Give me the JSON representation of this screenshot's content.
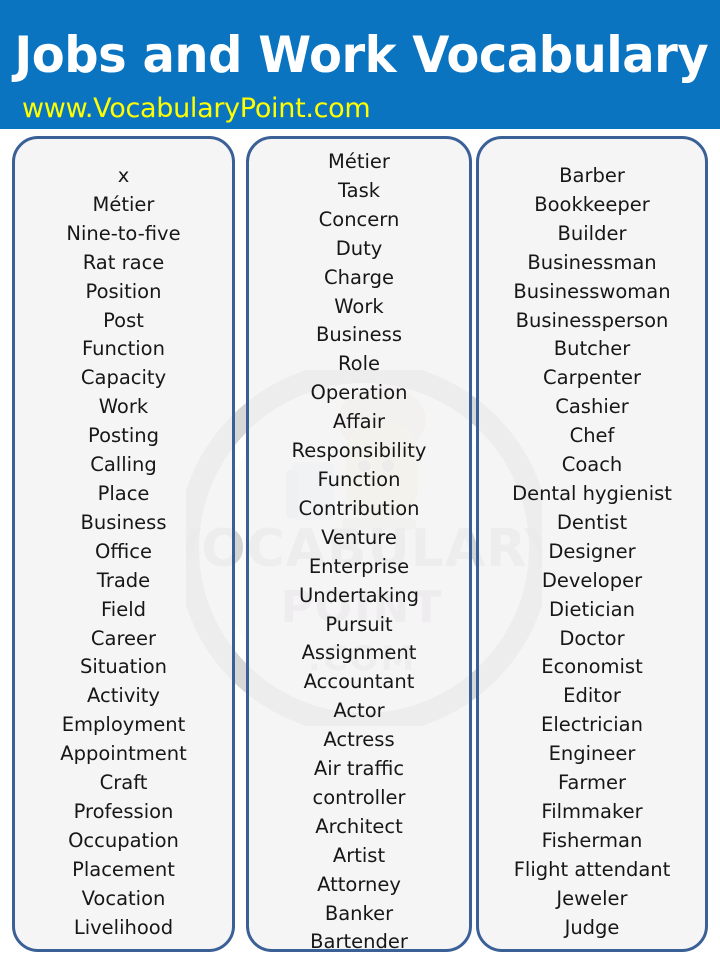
{
  "header": {
    "title": "Jobs and Work Vocabulary",
    "url": "www.VocabularyPoint.com",
    "background_color": "#0a74c1",
    "title_color": "#ffffff",
    "url_color": "#ffff00"
  },
  "watermark": {
    "brand_line_1": "VOCABULARY",
    "brand_line_2": "POINT",
    "brand_line_3": ".COM",
    "color": "#c9c9c9"
  },
  "card_style": {
    "border_color": "#3a6095",
    "fill_color": "#f2f2f2",
    "text_color": "#171717"
  },
  "columns": [
    {
      "id": "column-1",
      "items": [
        "x",
        "Métier",
        "Nine-to-five",
        "Rat race",
        "Position",
        "Post",
        "Function",
        "Capacity",
        "Work",
        "Posting",
        "Calling",
        "Place",
        "Business",
        "Office",
        "Trade",
        "Field",
        "Career",
        "Situation",
        "Activity",
        "Employment",
        "Appointment",
        "Craft",
        "Profession",
        "Occupation",
        "Placement",
        "Vocation",
        "Livelihood"
      ]
    },
    {
      "id": "column-2",
      "items": [
        "Métier",
        "Task",
        "Concern",
        "Duty",
        "Charge",
        "Work",
        "Business",
        "Role",
        "Operation",
        "Affair",
        "Responsibility",
        "Function",
        "Contribution",
        "Venture",
        "Enterprise",
        "Undertaking",
        "Pursuit",
        "Assignment",
        "Accountant",
        "Actor",
        "Actress",
        "Air traffic",
        "controller",
        "Architect",
        "Artist",
        "Attorney",
        "Banker",
        "Bartender"
      ]
    },
    {
      "id": "column-3",
      "items": [
        "Barber",
        "Bookkeeper",
        "Builder",
        "Businessman",
        "Businesswoman",
        "Businessperson",
        "Butcher",
        "Carpenter",
        "Cashier",
        "Chef",
        "Coach",
        "Dental hygienist",
        "Dentist",
        "Designer",
        "Developer",
        "Dietician",
        "Doctor",
        "Economist",
        "Editor",
        "Electrician",
        "Engineer",
        "Farmer",
        "Filmmaker",
        "Fisherman",
        "Flight attendant",
        "Jeweler",
        "Judge"
      ]
    }
  ]
}
